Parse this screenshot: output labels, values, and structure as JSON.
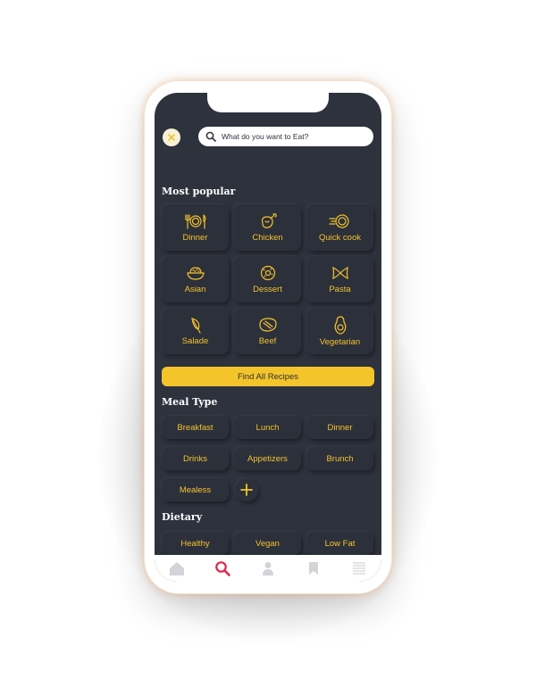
{
  "search": {
    "placeholder": "What do you want to Eat?"
  },
  "sections": {
    "most_popular": "Most popular",
    "meal_type": "Meal Type",
    "dietary": "Dietary"
  },
  "popular": [
    {
      "label": "Dinner",
      "icon": "plate-cutlery-icon"
    },
    {
      "label": "Chicken",
      "icon": "chicken-icon"
    },
    {
      "label": "Quick cook",
      "icon": "speed-plate-icon"
    },
    {
      "label": "Asian",
      "icon": "rice-bowl-icon"
    },
    {
      "label": "Dessert",
      "icon": "donut-icon"
    },
    {
      "label": "Pasta",
      "icon": "pasta-icon"
    },
    {
      "label": "Salade",
      "icon": "leaf-icon"
    },
    {
      "label": "Beef",
      "icon": "steak-icon"
    },
    {
      "label": "Vegetarian",
      "icon": "avocado-icon"
    }
  ],
  "find_all": "Find All Recipes",
  "meal_types": [
    "Breakfast",
    "Lunch",
    "Dinner",
    "Drinks",
    "Appetizers",
    "Brunch",
    "Mealess"
  ],
  "dietary": [
    "Healthy",
    "Vegan",
    "Low Fat"
  ],
  "tabs": [
    {
      "icon": "home-icon",
      "active": false
    },
    {
      "icon": "search-icon",
      "active": true
    },
    {
      "icon": "profile-icon",
      "active": false
    },
    {
      "icon": "bookmark-icon",
      "active": false
    },
    {
      "icon": "list-icon",
      "active": false
    }
  ],
  "colors": {
    "background": "#2e323d",
    "accent": "#f4c52b",
    "active_tab": "#e0264b",
    "inactive_tab": "#d3d3d8"
  }
}
